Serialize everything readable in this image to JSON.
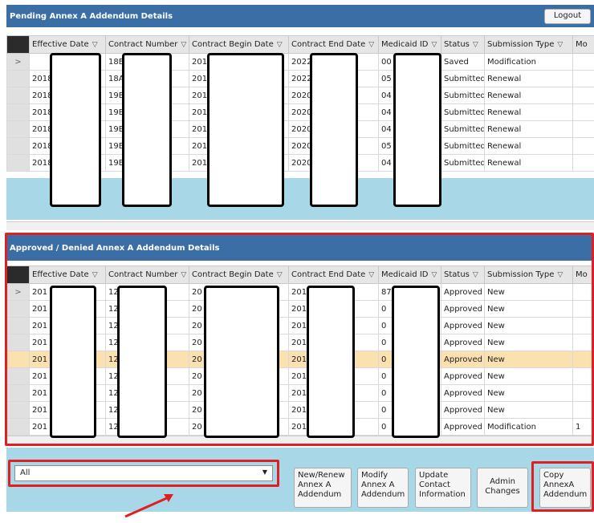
{
  "pending": {
    "title": "Pending Annex A Addendum Details",
    "logout_label": "Logout",
    "columns": [
      "Effective Date",
      "Contract Number",
      "Contract Begin Date",
      "Contract End Date",
      "Medicaid ID",
      "Status",
      "Submission Type",
      "Mo"
    ],
    "rows": [
      {
        "marker": ">",
        "eff": "",
        "contract": "18E",
        "begin": "201",
        "end": "2022",
        "medicaid": "00",
        "status": "Saved",
        "type": "Modification"
      },
      {
        "marker": "",
        "eff": "2018",
        "contract": "18A",
        "begin": "201",
        "end": "2022",
        "medicaid": "05",
        "status": "Submitted",
        "type": "Renewal"
      },
      {
        "marker": "",
        "eff": "2018",
        "contract": "19B",
        "begin": "201",
        "end": "2020",
        "medicaid": "04",
        "status": "Submitted",
        "type": "Renewal"
      },
      {
        "marker": "",
        "eff": "2018",
        "contract": "19B",
        "begin": "201",
        "end": "2020",
        "medicaid": "04",
        "status": "Submitted",
        "type": "Renewal"
      },
      {
        "marker": "",
        "eff": "2018",
        "contract": "19B",
        "begin": "201",
        "end": "2020",
        "medicaid": "04",
        "status": "Submitted",
        "type": "Renewal"
      },
      {
        "marker": "",
        "eff": "2018",
        "contract": "19B",
        "begin": "201",
        "end": "2020",
        "medicaid": "05",
        "status": "Submitted",
        "type": "Renewal"
      },
      {
        "marker": "",
        "eff": "2018",
        "contract": "19B",
        "begin": "201",
        "end": "2020",
        "medicaid": "04",
        "status": "Submitted",
        "type": "Renewal"
      }
    ]
  },
  "approved": {
    "title": "Approved / Denied Annex A Addendum Details",
    "columns": [
      "Effective Date",
      "Contract Number",
      "Contract Begin Date",
      "Contract End Date",
      "Medicaid ID",
      "Status",
      "Submission Type",
      "Mo"
    ],
    "rows": [
      {
        "marker": ">",
        "eff": "201",
        "contract": "12",
        "begin": "20",
        "end": "201",
        "medicaid": "87",
        "status": "Approved",
        "type": "New",
        "extra": ""
      },
      {
        "marker": "",
        "eff": "201",
        "contract": "12",
        "begin": "20",
        "end": "201",
        "medicaid": "0",
        "status": "Approved",
        "type": "New",
        "extra": ""
      },
      {
        "marker": "",
        "eff": "201",
        "contract": "12",
        "begin": "20",
        "end": "201",
        "medicaid": "0",
        "status": "Approved",
        "type": "New",
        "extra": ""
      },
      {
        "marker": "",
        "eff": "201",
        "contract": "12",
        "begin": "20",
        "end": "201",
        "medicaid": "0",
        "status": "Approved",
        "type": "New",
        "extra": ""
      },
      {
        "marker": "",
        "eff": "201",
        "contract": "12",
        "begin": "20",
        "end": "201",
        "medicaid": "0",
        "status": "Approved",
        "type": "New",
        "extra": "",
        "highlight": true
      },
      {
        "marker": "",
        "eff": "201",
        "contract": "12",
        "begin": "20",
        "end": "201",
        "medicaid": "0",
        "status": "Approved",
        "type": "New",
        "extra": ""
      },
      {
        "marker": "",
        "eff": "201",
        "contract": "12",
        "begin": "20",
        "end": "201",
        "medicaid": "0",
        "status": "Approved",
        "type": "New",
        "extra": ""
      },
      {
        "marker": "",
        "eff": "201",
        "contract": "12",
        "begin": "20",
        "end": "201",
        "medicaid": "0",
        "status": "Approved",
        "type": "New",
        "extra": ""
      },
      {
        "marker": "",
        "eff": "201",
        "contract": "12",
        "begin": "20",
        "end": "201",
        "medicaid": "0",
        "status": "Approved",
        "type": "Modification",
        "extra": "1"
      }
    ]
  },
  "filter": {
    "selected": "All"
  },
  "buttons": {
    "new_renew": "New/Renew\nAnnex A\nAddendum",
    "modify": "Modify\nAnnex A\nAddendum",
    "update_contact": "Update\nContact\nInformation",
    "admin_changes": "Admin\nChanges",
    "copy": "Copy\nAnnexA\nAddendum"
  },
  "colors": {
    "header_bar": "#3a6ea5",
    "highlight_row": "#fbe0b0",
    "annotation_red": "#e02020",
    "bottom_panel": "#a8d7e8"
  },
  "icons": {
    "filter": "funnel-icon",
    "row_marker": "chevron-right-icon",
    "dropdown": "caret-down-icon",
    "annotation": "red-arrow-icon"
  }
}
